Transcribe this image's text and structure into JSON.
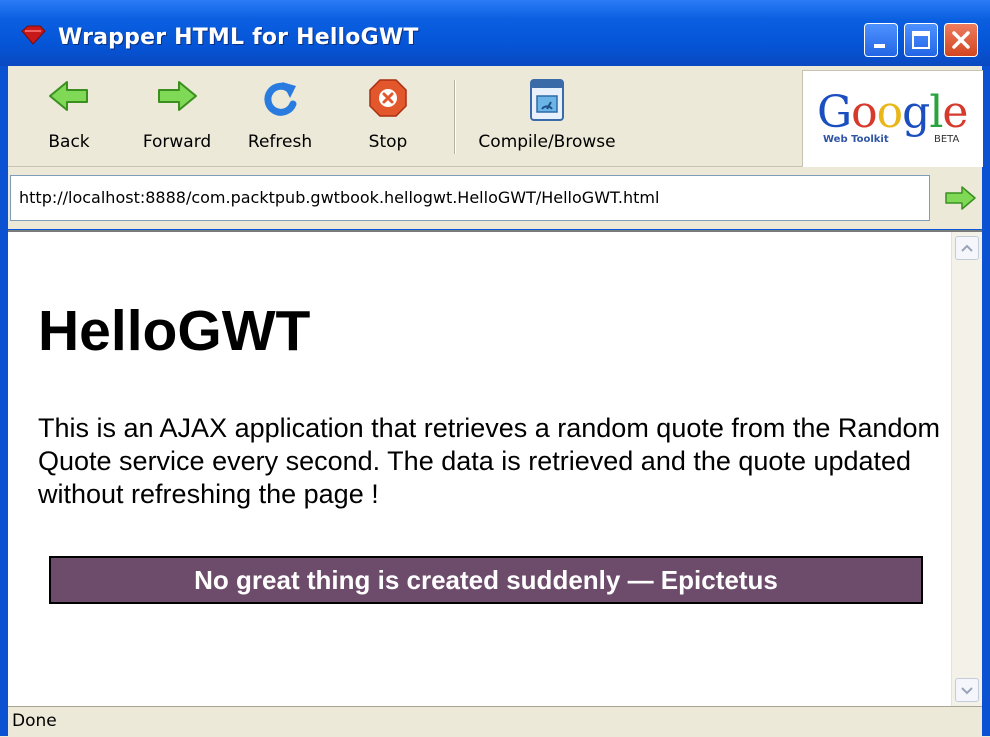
{
  "window": {
    "title": "Wrapper HTML for HelloGWT"
  },
  "toolbar": {
    "buttons": [
      {
        "label": "Back",
        "icon": "back-arrow-icon"
      },
      {
        "label": "Forward",
        "icon": "forward-arrow-icon"
      },
      {
        "label": "Refresh",
        "icon": "refresh-icon"
      },
      {
        "label": "Stop",
        "icon": "stop-icon"
      },
      {
        "label": "Compile/Browse",
        "icon": "compile-browse-icon"
      }
    ]
  },
  "logo": {
    "word": "Google",
    "sub": "Web Toolkit",
    "badge": "BETA"
  },
  "address": {
    "url": "http://localhost:8888/com.packtpub.gwtbook.hellogwt.HelloGWT/HelloGWT.html",
    "go_icon": "go-arrow-icon"
  },
  "page": {
    "title": "HelloGWT",
    "description": "This is an AJAX application that retrieves a random quote from the Random Quote service every second. The data is retrieved and the quote updated without refreshing the page !",
    "quote": "No great thing is created suddenly — Epictetus"
  },
  "status": {
    "text": "Done"
  },
  "colors": {
    "quote_bg": "#6d4b6b",
    "titlebar": "#0554d6",
    "chrome": "#ece9d8"
  }
}
